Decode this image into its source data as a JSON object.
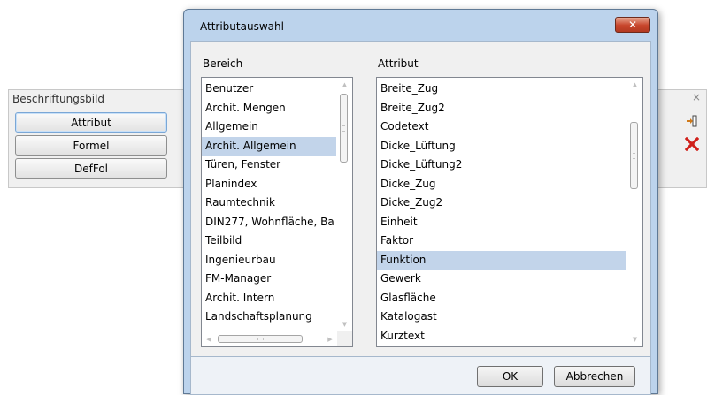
{
  "palette": {
    "title": "Beschriftungsbild",
    "close_glyph": "×",
    "buttons": [
      {
        "label": "Attribut",
        "active": true
      },
      {
        "label": "Formel",
        "active": false
      },
      {
        "label": "DefFol",
        "active": false
      }
    ],
    "icons": [
      "insert-column-icon",
      "delete-x-icon"
    ]
  },
  "dialog": {
    "title": "Attributauswahl",
    "close_glyph": "✕",
    "bereich": {
      "label": "Bereich",
      "items": [
        "Benutzer",
        "Archit. Mengen",
        "Allgemein",
        "Archit. Allgemein",
        "Türen, Fenster",
        "Planindex",
        "Raumtechnik",
        "DIN277, Wohnfläche, Ba",
        "Teilbild",
        "Ingenieurbau",
        "FM-Manager",
        "Archit. Intern",
        "Landschaftsplanung"
      ],
      "selected_index": 3
    },
    "attribut": {
      "label": "Attribut",
      "items": [
        "Breite_Zug",
        "Breite_Zug2",
        "Codetext",
        "Dicke_Lüftung",
        "Dicke_Lüftung2",
        "Dicke_Zug",
        "Dicke_Zug2",
        "Einheit",
        "Faktor",
        "Funktion",
        "Gewerk",
        "Glasfläche",
        "Katalogast",
        "Kurztext"
      ],
      "selected_index": 9
    },
    "ok_label": "OK",
    "cancel_label": "Abbrechen"
  },
  "colors": {
    "selection": "#c2d4ea",
    "dialog_frame": "#bcd3ec",
    "close_button": "#c7452b",
    "delete_icon": "#d0201a"
  }
}
